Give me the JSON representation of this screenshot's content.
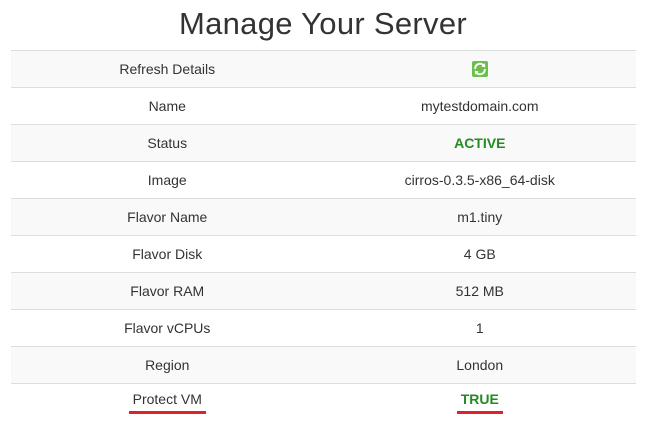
{
  "page": {
    "title": "Manage Your Server"
  },
  "server_details": {
    "refresh": {
      "label": "Refresh Details",
      "icon": "refresh-icon"
    },
    "rows": [
      {
        "label": "Name",
        "value": "mytestdomain.com"
      },
      {
        "label": "Status",
        "value": "ACTIVE"
      },
      {
        "label": "Image",
        "value": "cirros-0.3.5-x86_64-disk"
      },
      {
        "label": "Flavor Name",
        "value": "m1.tiny"
      },
      {
        "label": "Flavor Disk",
        "value": "4 GB"
      },
      {
        "label": "Flavor RAM",
        "value": "512 MB"
      },
      {
        "label": "Flavor vCPUs",
        "value": "1"
      },
      {
        "label": "Region",
        "value": "London"
      },
      {
        "label": "Protect VM",
        "value": "TRUE"
      }
    ]
  },
  "colors": {
    "status_active": "#228b22",
    "protect_true": "#228b22",
    "refresh_icon": "#5cb85c",
    "highlight_underline": "#e0202a",
    "row_border": "#dddddd"
  }
}
